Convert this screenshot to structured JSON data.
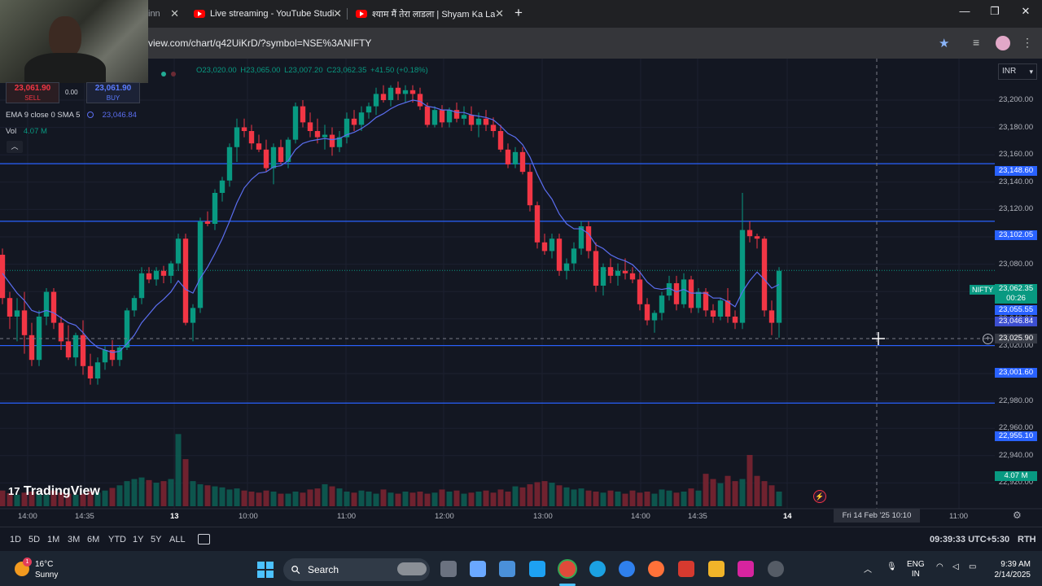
{
  "browser": {
    "tabs": [
      {
        "label": "inn",
        "active": true
      },
      {
        "label": "Live streaming - YouTube Studi"
      },
      {
        "label": "श्याम मैं तेरा लाडला | Shyam Ka La"
      }
    ],
    "url": "view.com/chart/q42UiKrD/?symbol=NSE%3ANIFTY"
  },
  "trade": {
    "sell_price": "23,061.90",
    "sell_label": "SELL",
    "spread": "0.00",
    "buy_price": "23,061.90",
    "buy_label": "BUY"
  },
  "ohlc": {
    "o": "O23,020.00",
    "h": "H23,065.00",
    "l": "L23,007.20",
    "c": "C23,062.35",
    "change": "+41.50 (+0.18%)"
  },
  "indicators": {
    "ema_label": "EMA 9 close 0 SMA 5",
    "ema_value": "23,046.84",
    "vol_label": "Vol",
    "vol_value": "4.07 M"
  },
  "currency": "INR",
  "brand": "TradingView",
  "symbol_tag": "NIFTY",
  "price_axis": {
    "ticks": [
      "23,200.00",
      "23,180.00",
      "23,160.00",
      "23,140.00",
      "23,120.00",
      "23,100.00",
      "23,080.00",
      "23,060.00",
      "23,040.00",
      "23,020.00",
      "23,000.00",
      "22,980.00",
      "22,960.00",
      "22,940.00",
      "22,920.00"
    ],
    "hlines": [
      {
        "label": "23,148.60"
      },
      {
        "label": "23,102.05"
      },
      {
        "label": "23,001.60"
      },
      {
        "label": "22,955.10"
      }
    ],
    "last_price": "23,062.35",
    "countdown": "00:26",
    "sma_price": "23,055.55",
    "ema_price": "23,046.84",
    "crosshair_price": "23,025.90",
    "volume_label": "4.07 M"
  },
  "time_axis": {
    "labels": [
      "14:00",
      "14:35",
      "13",
      "10:00",
      "11:00",
      "12:00",
      "13:00",
      "14:00",
      "14:35",
      "14",
      "11:00"
    ],
    "crosshair_time": "Fri 14 Feb '25   10:10"
  },
  "ranges": [
    "1D",
    "5D",
    "1M",
    "3M",
    "6M",
    "YTD",
    "1Y",
    "5Y",
    "ALL"
  ],
  "clock": "09:39:33 UTC+5:30",
  "rth": "RTH",
  "taskbar": {
    "temp": "16°C",
    "weather": "Sunny",
    "weather_badge": "1",
    "search": "Search",
    "lang1": "ENG",
    "lang2": "IN",
    "time": "9:39 AM",
    "date": "2/14/2025"
  },
  "colors": {
    "up": "#089981",
    "down": "#f23645",
    "hline": "#2962ff",
    "ema": "#5b6ef0"
  },
  "chart_data": {
    "type": "candlestick",
    "title": "",
    "ylim": [
      22915,
      23215
    ],
    "hlines": [
      23148.6,
      23102.05,
      23001.6,
      22955.1
    ],
    "candles": [
      [
        23075,
        23080,
        23035,
        23040
      ],
      [
        23040,
        23045,
        23015,
        23025
      ],
      [
        23025,
        23040,
        23005,
        23030
      ],
      [
        23030,
        23045,
        22995,
        23010
      ],
      [
        23010,
        23020,
        22985,
        22990
      ],
      [
        22990,
        23030,
        22985,
        23025
      ],
      [
        23025,
        23048,
        23018,
        23045
      ],
      [
        23045,
        23048,
        23015,
        23020
      ],
      [
        23020,
        23025,
        22998,
        23005
      ],
      [
        23005,
        23018,
        22990,
        22992
      ],
      [
        22992,
        23012,
        22985,
        23010
      ],
      [
        23010,
        23022,
        22978,
        22985
      ],
      [
        22985,
        22995,
        22970,
        22975
      ],
      [
        22975,
        22992,
        22970,
        22988
      ],
      [
        22988,
        23001,
        22982,
        22998
      ],
      [
        22998,
        23006,
        22985,
        22990
      ],
      [
        22990,
        23002,
        22985,
        23000
      ],
      [
        23000,
        23032,
        22998,
        23030
      ],
      [
        23030,
        23042,
        23025,
        23040
      ],
      [
        23040,
        23065,
        23035,
        23060
      ],
      [
        23060,
        23065,
        23052,
        23055
      ],
      [
        23055,
        23065,
        23050,
        23062
      ],
      [
        23062,
        23066,
        23052,
        23058
      ],
      [
        23058,
        23070,
        23052,
        23068
      ],
      [
        23068,
        23092,
        23062,
        23088
      ],
      [
        23088,
        23092,
        23018,
        23020
      ],
      [
        23020,
        23035,
        23005,
        23032
      ],
      [
        23032,
        23105,
        23028,
        23102
      ],
      [
        23102,
        23110,
        23098,
        23100
      ],
      [
        23100,
        23128,
        23095,
        23125
      ],
      [
        23125,
        23138,
        23118,
        23135
      ],
      [
        23135,
        23165,
        23130,
        23162
      ],
      [
        23162,
        23185,
        23150,
        23178
      ],
      [
        23178,
        23185,
        23170,
        23175
      ],
      [
        23175,
        23180,
        23160,
        23165
      ],
      [
        23165,
        23172,
        23158,
        23160
      ],
      [
        23160,
        23168,
        23142,
        23145
      ],
      [
        23145,
        23165,
        23132,
        23162
      ],
      [
        23162,
        23168,
        23148,
        23150
      ],
      [
        23150,
        23170,
        23145,
        23168
      ],
      [
        23168,
        23198,
        23165,
        23195
      ],
      [
        23195,
        23200,
        23178,
        23182
      ],
      [
        23182,
        23190,
        23170,
        23175
      ],
      [
        23175,
        23185,
        23165,
        23170
      ],
      [
        23170,
        23180,
        23160,
        23172
      ],
      [
        23172,
        23178,
        23155,
        23162
      ],
      [
        23162,
        23175,
        23158,
        23170
      ],
      [
        23170,
        23190,
        23165,
        23185
      ],
      [
        23185,
        23192,
        23175,
        23180
      ],
      [
        23180,
        23195,
        23175,
        23190
      ],
      [
        23190,
        23198,
        23185,
        23195
      ],
      [
        23195,
        23210,
        23188,
        23205
      ],
      [
        23205,
        23212,
        23198,
        23200
      ],
      [
        23200,
        23212,
        23195,
        23210
      ],
      [
        23210,
        23215,
        23200,
        23205
      ],
      [
        23205,
        23212,
        23198,
        23208
      ],
      [
        23208,
        23212,
        23198,
        23205
      ],
      [
        23205,
        23210,
        23192,
        23195
      ],
      [
        23195,
        23198,
        23178,
        23180
      ],
      [
        23180,
        23195,
        23178,
        23192
      ],
      [
        23192,
        23196,
        23178,
        23182
      ],
      [
        23182,
        23194,
        23178,
        23192
      ],
      [
        23192,
        23198,
        23182,
        23185
      ],
      [
        23185,
        23195,
        23180,
        23188
      ],
      [
        23188,
        23195,
        23175,
        23180
      ],
      [
        23180,
        23190,
        23170,
        23185
      ],
      [
        23185,
        23192,
        23175,
        23180
      ],
      [
        23180,
        23186,
        23170,
        23175
      ],
      [
        23175,
        23180,
        23158,
        23160
      ],
      [
        23160,
        23165,
        23145,
        23148
      ],
      [
        23148,
        23162,
        23145,
        23158
      ],
      [
        23158,
        23162,
        23140,
        23142
      ],
      [
        23142,
        23148,
        23110,
        23115
      ],
      [
        23115,
        23118,
        23080,
        23085
      ],
      [
        23085,
        23092,
        23075,
        23078
      ],
      [
        23078,
        23092,
        23072,
        23088
      ],
      [
        23088,
        23092,
        23058,
        23062
      ],
      [
        23062,
        23072,
        23055,
        23068
      ],
      [
        23068,
        23085,
        23062,
        23080
      ],
      [
        23080,
        23102,
        23075,
        23098
      ],
      [
        23098,
        23102,
        23072,
        23078
      ],
      [
        23078,
        23085,
        23045,
        23050
      ],
      [
        23050,
        23068,
        23042,
        23065
      ],
      [
        23065,
        23072,
        23052,
        23058
      ],
      [
        23058,
        23068,
        23050,
        23062
      ],
      [
        23062,
        23072,
        23055,
        23060
      ],
      [
        23060,
        23065,
        23052,
        23055
      ],
      [
        23055,
        23062,
        23030,
        23035
      ],
      [
        23035,
        23040,
        23018,
        23022
      ],
      [
        23022,
        23030,
        23012,
        23028
      ],
      [
        23028,
        23045,
        23022,
        23042
      ],
      [
        23042,
        23058,
        23038,
        23052
      ],
      [
        23052,
        23058,
        23030,
        23035
      ],
      [
        23035,
        23060,
        23032,
        23055
      ],
      [
        23055,
        23058,
        23028,
        23032
      ],
      [
        23032,
        23048,
        23028,
        23045
      ],
      [
        23045,
        23048,
        23025,
        23030
      ],
      [
        23030,
        23035,
        23020,
        23025
      ],
      [
        23025,
        23040,
        23022,
        23038
      ],
      [
        23038,
        23048,
        23020,
        23025
      ],
      [
        23025,
        23030,
        23015,
        23020
      ],
      [
        23020,
        23125,
        23015,
        23095
      ],
      [
        23095,
        23102,
        23085,
        23090
      ],
      [
        23090,
        23092,
        23080,
        23088
      ],
      [
        23088,
        23090,
        23025,
        23030
      ],
      [
        23030,
        23038,
        23010,
        23020
      ],
      [
        23020,
        23065,
        23008,
        23062
      ]
    ],
    "ema": [
      23060,
      23052,
      23044,
      23038,
      23030,
      23028,
      23030,
      23028,
      23024,
      23020,
      23018,
      23012,
      23005,
      23000,
      22998,
      22996,
      22997,
      23003,
      23010,
      23020,
      23027,
      23034,
      23039,
      23045,
      23054,
      23047,
      23044,
      23056,
      23065,
      23076,
      23088,
      23102,
      23117,
      23129,
      23136,
      23141,
      23142,
      23146,
      23147,
      23151,
      23160,
      23165,
      23167,
      23168,
      23169,
      23168,
      23169,
      23172,
      23174,
      23177,
      23181,
      23186,
      23189,
      23193,
      23196,
      23198,
      23200,
      23199,
      23195,
      23194,
      23192,
      23192,
      23190,
      23190,
      23188,
      23187,
      23186,
      23184,
      23179,
      23173,
      23170,
      23164,
      23154,
      23140,
      23128,
      23120,
      23108,
      23100,
      23096,
      23096,
      23092,
      23083,
      23080,
      23075,
      23072,
      23070,
      23067,
      23061,
      23053,
      23048,
      23047,
      23048,
      23045,
      23047,
      23044,
      23044,
      23044,
      23040,
      23040,
      23037,
      23033,
      23045,
      23054,
      23061,
      23055,
      23048,
      23051
    ],
    "volume": [
      30,
      25,
      22,
      26,
      28,
      24,
      22,
      30,
      26,
      24,
      22,
      24,
      28,
      26,
      30,
      35,
      40,
      48,
      52,
      55,
      50,
      45,
      48,
      52,
      138,
      90,
      48,
      42,
      40,
      38,
      36,
      32,
      34,
      30,
      28,
      26,
      30,
      28,
      24,
      24,
      28,
      26,
      32,
      34,
      42,
      38,
      34,
      28,
      26,
      30,
      28,
      24,
      32,
      26,
      24,
      28,
      26,
      28,
      24,
      26,
      32,
      28,
      30,
      24,
      26,
      28,
      30,
      26,
      32,
      28,
      38,
      36,
      42,
      46,
      48,
      45,
      40,
      36,
      32,
      34,
      30,
      28,
      26,
      30,
      28,
      24,
      30,
      26,
      28,
      24,
      32,
      30,
      26,
      28,
      34,
      30,
      62,
      52,
      44,
      58,
      48,
      52,
      98,
      58,
      48,
      40,
      28
    ],
    "volume_max": 140
  }
}
